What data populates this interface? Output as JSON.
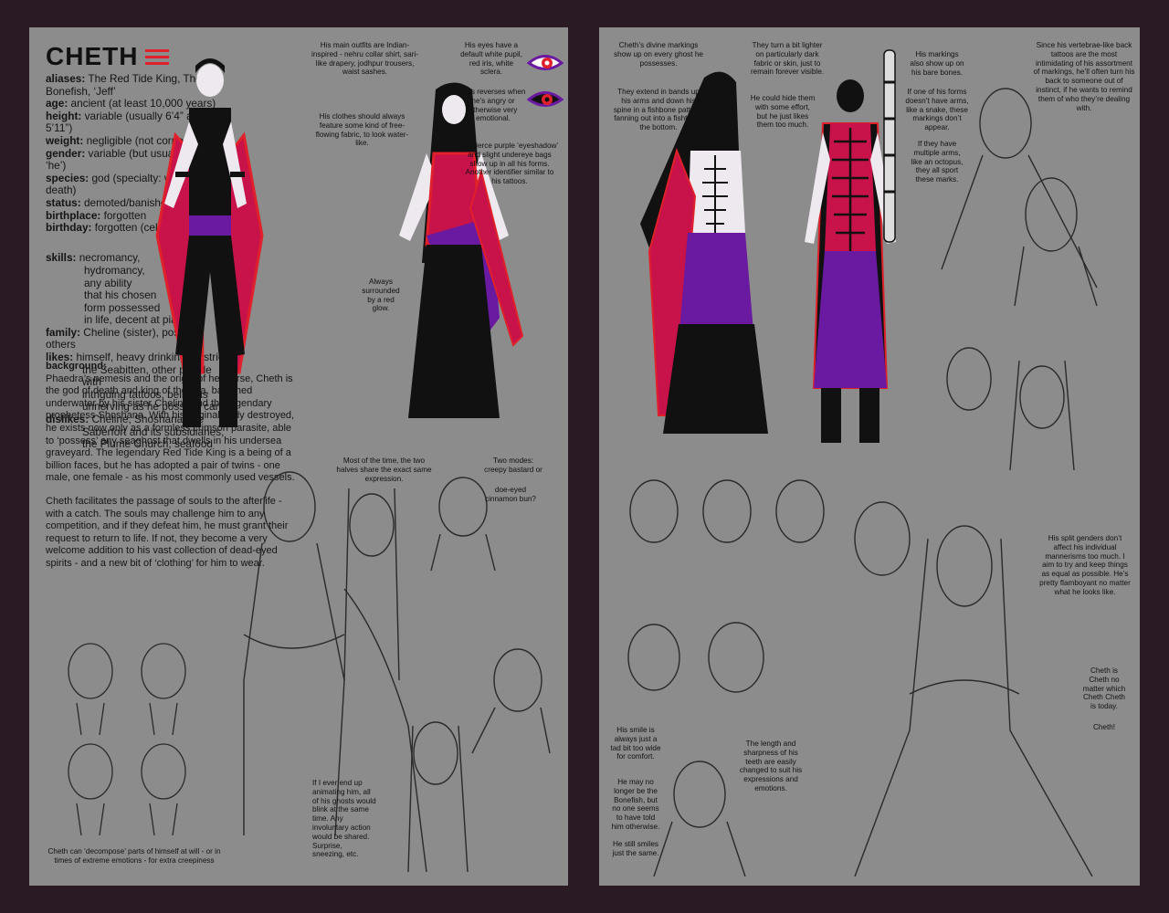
{
  "left": {
    "title": "CHETH",
    "profile": {
      "aliases": {
        "label": "aliases:",
        "value": " The Red Tide King, The Bonefish, ‘Jeff’"
      },
      "age": {
        "label": "age:",
        "value": " ancient (at least 10,000 years)"
      },
      "height": {
        "label": "height:",
        "value": " variable (usually 6’4” and 5’11”)"
      },
      "weight": {
        "label": "weight:",
        "value": " negligible (not corporeal)"
      },
      "gender": {
        "label": "gender:",
        "value": " variable (but usually goes by ‘he’)"
      },
      "species": {
        "label": "species:",
        "value": " god (specialty: water and death)"
      },
      "status": {
        "label": "status:",
        "value": " demoted/banished/‘deceased’"
      },
      "birthplace": {
        "label": "birthplace:",
        "value": " forgotten"
      },
      "birthday": {
        "label": "birthday:",
        "value": " forgotten (celebrated",
        "cont": "December 20)"
      },
      "skills": {
        "label": "skills:",
        "lines": [
          " necromancy,",
          "hydromancy,",
          "any ability",
          "that his chosen",
          "form possessed",
          "in life, decent at piano"
        ]
      },
      "family": {
        "label": "family:",
        "value": " Cheline (sister), possibly others"
      },
      "likes": {
        "label": "likes:",
        "lines": [
          " himself, heavy drinking, pastries,",
          "the Seabitten, other people with",
          "intriguing tattoos, being as",
          "unnerving as he possibly can"
        ]
      },
      "dislikes": {
        "label": "dislikes:",
        "lines": [
          " Cheline, Shoshana, the",
          "Saberfort and its subsidiaries,",
          "the Plume Church, seafood"
        ]
      }
    },
    "background": {
      "heading": "background:",
      "p1": "Phaedra’s nemesis and the origin of her curse, Cheth is the god of death and king of the sea, banished underwater by his sister Cheline and the legendary prophetess Shoshana. With his original body destroyed, he exists now only as a formless crimson parasite, able to ‘possess’ any seaghost that dwells in his undersea graveyard. The legendary Red Tide King is a being of a billion faces, but he has adopted a pair of twins - one male, one female - as his most commonly used vessels.",
      "p2": "Cheth facilitates the passage of souls to the afterlife - with a catch. The souls may challenge him to any competition, and if they defeat him, he must grant their request to return to life. If not, they become a very welcome addition to his vast collection of dead-eyed spirits - and a new bit of ‘clothing’ for him to wear."
    },
    "notes": {
      "outfits": "His main outfits are Indian-inspired - nehru collar shirt, sari-like drapery, jodhpur trousers, waist sashes.",
      "water": "His clothes should always feature some kind of free-flowing fabric, to look water-like.",
      "eyes": "His eyes have a default white pupil, red iris, white sclera.",
      "reverses": "This reverses when he’s angry or otherwise very emotional.",
      "eyeshadow": "His fierce purple ‘eyeshadow’ and slight undereye bags show up in all his forms. Another identifier similar to his tattoos.",
      "glow": "Always surrounded by a red glow.",
      "expression": "Most of the time, the two halves share the exact same expression.",
      "modes1": "Two modes: creepy bastard or",
      "modes2": "doe-eyed cinnamon bun?",
      "animating": "If I ever end up animating him, all of his ghosts would blink at the same time. Any involuntary action would be shared. Surprise, sneezing, etc.",
      "decompose": "Cheth can ‘decompose’ parts of himself at will - or in times of extreme emotions - for extra creepiness"
    }
  },
  "right": {
    "notes": {
      "markings": "Cheth’s divine markings show up on every ghost he possesses.",
      "bands": "They extend in bands up his arms and down his spine in a fishbone pattern, fanning out into a fishtail at the bottom.",
      "lighter": "They turn a bit lighter on particularly dark fabric or skin, just to remain forever visible.",
      "hide": "He could hide them with some effort, but he just likes them too much.",
      "bones": "His markings also show up on his bare bones.",
      "arms": "If one of his forms doesn’t have arms, like a snake, these markings don’t appear.",
      "multiple": "If they have multiple arms, like an octopus, they all sport these marks.",
      "vertebrae": "Since his vertebrae-like back tattoos are the most intimidating of his assortment of markings, he’ll often turn his back to someone out of instinct, if he wants to remind them of who they’re dealing with.",
      "genders": "His split genders don’t affect his individual mannerisms too much. I aim to try and keep things as equal as possible. He’s pretty flamboyant no matter what he looks like.",
      "cheth_is": "Cheth is Cheth no matter which Cheth Cheth is today.",
      "cheth_excl": "Cheth!",
      "smile": "His smile is always just a tad bit too wide for comfort.",
      "bonefish": "He may no longer be the Bonefish, but no one seems to have told him otherwise.",
      "still": "He still smiles just the same.",
      "teeth": "The length and sharpness of his teeth are easily changed to suit his expressions and emotions."
    }
  },
  "colors": {
    "accent_red": "#e0202a",
    "purple": "#6a1aa0",
    "magenta": "#c8124a",
    "panel": "#8c8c8c",
    "frame": "#2a1a24"
  }
}
